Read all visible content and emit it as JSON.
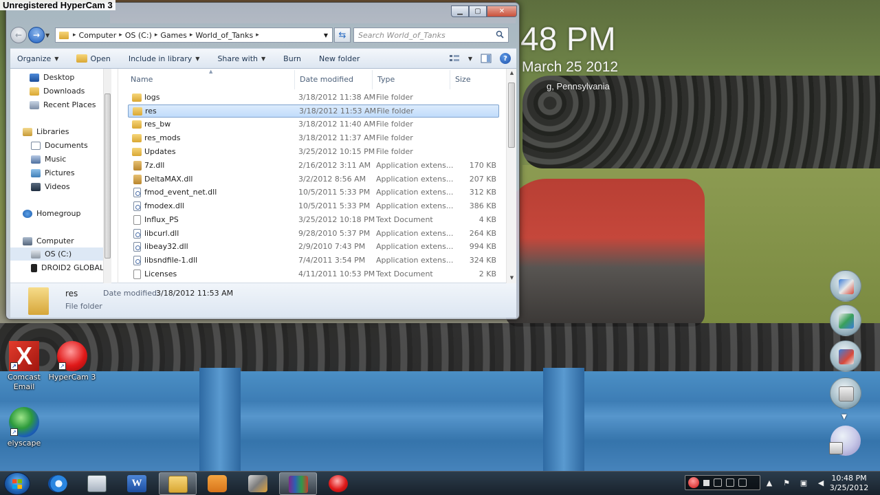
{
  "watermark": "Unregistered HyperCam 3",
  "clock_gadget": {
    "time": "48 PM",
    "date": "March 25 2012",
    "location": "g, Pennsylvania"
  },
  "window": {
    "address": {
      "crumbs": [
        "Computer",
        "OS (C:)",
        "Games",
        "World_of_Tanks"
      ]
    },
    "search": {
      "placeholder": "Search World_of_Tanks"
    },
    "toolbar": {
      "organize": "Organize",
      "open": "Open",
      "include": "Include in library",
      "share": "Share with",
      "burn": "Burn",
      "new_folder": "New folder"
    },
    "nav": [
      {
        "label": "Desktop",
        "icon": "desktop-icon"
      },
      {
        "label": "Downloads",
        "icon": "downloads-icon"
      },
      {
        "label": "Recent Places",
        "icon": "recent-places-icon"
      },
      {
        "label": "Libraries",
        "icon": "libraries-icon"
      },
      {
        "label": "Documents",
        "icon": "documents-icon"
      },
      {
        "label": "Music",
        "icon": "music-icon"
      },
      {
        "label": "Pictures",
        "icon": "pictures-icon"
      },
      {
        "label": "Videos",
        "icon": "videos-icon"
      },
      {
        "label": "Homegroup",
        "icon": "homegroup-icon"
      },
      {
        "label": "Computer",
        "icon": "computer-icon"
      },
      {
        "label": "OS (C:)",
        "icon": "drive-icon"
      },
      {
        "label": "DROID2 GLOBAL",
        "icon": "phone-icon"
      }
    ],
    "columns": {
      "name": "Name",
      "date": "Date modified",
      "type": "Type",
      "size": "Size"
    },
    "files": [
      {
        "name": "logs",
        "date": "3/18/2012 11:38 AM",
        "type": "File folder",
        "size": "",
        "kind": "folder"
      },
      {
        "name": "res",
        "date": "3/18/2012 11:53 AM",
        "type": "File folder",
        "size": "",
        "kind": "folder",
        "selected": true
      },
      {
        "name": "res_bw",
        "date": "3/18/2012 11:40 AM",
        "type": "File folder",
        "size": "",
        "kind": "folder"
      },
      {
        "name": "res_mods",
        "date": "3/18/2012 11:37 AM",
        "type": "File folder",
        "size": "",
        "kind": "folder"
      },
      {
        "name": "Updates",
        "date": "3/25/2012 10:15 PM",
        "type": "File folder",
        "size": "",
        "kind": "folder"
      },
      {
        "name": "7z.dll",
        "date": "2/16/2012 3:11 AM",
        "type": "Application extens...",
        "size": "170 KB",
        "kind": "archive"
      },
      {
        "name": "DeltaMAX.dll",
        "date": "3/2/2012 8:56 AM",
        "type": "Application extens...",
        "size": "207 KB",
        "kind": "archive"
      },
      {
        "name": "fmod_event_net.dll",
        "date": "10/5/2011 5:33 PM",
        "type": "Application extens...",
        "size": "312 KB",
        "kind": "dll"
      },
      {
        "name": "fmodex.dll",
        "date": "10/5/2011 5:33 PM",
        "type": "Application extens...",
        "size": "386 KB",
        "kind": "dll"
      },
      {
        "name": "Influx_PS",
        "date": "3/25/2012 10:18 PM",
        "type": "Text Document",
        "size": "4 KB",
        "kind": "text"
      },
      {
        "name": "libcurl.dll",
        "date": "9/28/2010 5:37 PM",
        "type": "Application extens...",
        "size": "264 KB",
        "kind": "dll"
      },
      {
        "name": "libeay32.dll",
        "date": "2/9/2010 7:43 PM",
        "type": "Application extens...",
        "size": "994 KB",
        "kind": "dll"
      },
      {
        "name": "libsndfile-1.dll",
        "date": "7/4/2011 3:54 PM",
        "type": "Application extens...",
        "size": "324 KB",
        "kind": "dll"
      },
      {
        "name": "Licenses",
        "date": "4/11/2011 10:53 PM",
        "type": "Text Document",
        "size": "2 KB",
        "kind": "text"
      }
    ],
    "details": {
      "name": "res",
      "type": "File folder",
      "date_label": "Date modified:",
      "date_value": "3/18/2012 11:53 AM"
    }
  },
  "desktop_icons": [
    {
      "label": "Comcast Email",
      "icon": "comcast-email-icon"
    },
    {
      "label": "HyperCam 3",
      "icon": "hypercam-icon"
    },
    {
      "label": "elyscape",
      "icon": "elyscape-icon"
    }
  ],
  "taskbar": {
    "apps": [
      "internet-explorer-icon",
      "calculator-icon",
      "word-icon",
      "windows-explorer-icon",
      "media-center-icon",
      "tool-icon",
      "winrar-icon",
      "hypercam-taskbar-icon"
    ],
    "clock_time": "10:48 PM",
    "clock_date": "3/25/2012"
  }
}
